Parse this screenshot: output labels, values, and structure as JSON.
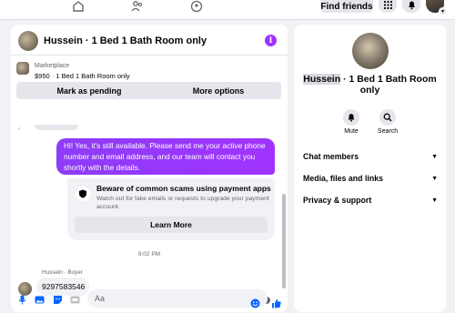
{
  "topnav": {
    "find_friends": "Find friends"
  },
  "chat": {
    "title": "Hussein · 1 Bed 1 Bath Room only",
    "listing": {
      "category": "Marketplace",
      "price_line": "$950 · 1 Bed 1 Bath Room only",
      "mark_pending": "Mark as pending",
      "more_options": "More options"
    },
    "outgoing_message": "Hi! Yes, it's still available. Please send me your active phone number and email address, and our team will contact you shortly with the details.",
    "scam_card": {
      "title": "Beware of common scams using payment apps",
      "subtitle": "Watch out for fake emails or requests to upgrade your payment account.",
      "button": "Learn More"
    },
    "timestamp": "9:02 PM",
    "incoming": {
      "sender": "Hussein · Buyer",
      "text": "9297583546"
    },
    "composer": {
      "placeholder": "Aa"
    }
  },
  "details": {
    "title_highlight": "Hussein",
    "title_rest": " · 1 Bed 1 Bath Room only",
    "actions": [
      {
        "label": "Mute",
        "icon": "bell-icon"
      },
      {
        "label": "Search",
        "icon": "search-icon"
      }
    ],
    "sections": [
      {
        "label": "Chat members"
      },
      {
        "label": "Media, files and links"
      },
      {
        "label": "Privacy & support"
      }
    ]
  },
  "colors": {
    "accent_purple": "#a033ff",
    "messenger_blue": "#0866ff",
    "background": "#f0f2f5"
  }
}
